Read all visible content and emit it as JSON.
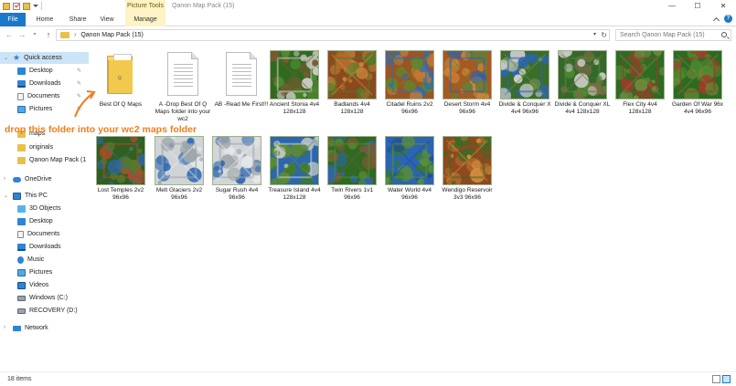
{
  "window": {
    "title": "Qanon Map Pack (15)",
    "context_tab_group": "Picture Tools",
    "controls": [
      "—",
      "☐",
      "✕"
    ]
  },
  "ribbon": {
    "tabs": [
      "File",
      "Home",
      "Share",
      "View",
      "Manage"
    ],
    "accent_color": "#1979ca",
    "context_color": "#fdf3c4"
  },
  "address": {
    "path": "Qanon Map Pack (15)",
    "search_placeholder": "Search Qanon Map Pack (15)"
  },
  "nav": {
    "items": [
      {
        "label": "Quick access",
        "icon": "star-icon",
        "selected": true
      },
      {
        "label": "Desktop",
        "icon": "desktop-icon",
        "pinned": true
      },
      {
        "label": "Downloads",
        "icon": "downloads-icon",
        "pinned": true
      },
      {
        "label": "Documents",
        "icon": "documents-icon",
        "pinned": true
      },
      {
        "label": "Pictures",
        "icon": "pictures-icon",
        "pinned": true
      },
      {
        "label": "maps",
        "icon": "folder-icon"
      },
      {
        "label": "originals",
        "icon": "folder-icon"
      },
      {
        "label": "Qanon Map Pack (1",
        "icon": "folder-icon"
      },
      {
        "label": "OneDrive",
        "icon": "cloud-icon"
      },
      {
        "label": "This PC",
        "icon": "pc-icon"
      },
      {
        "label": "3D Objects",
        "icon": "3d-objects-icon"
      },
      {
        "label": "Desktop",
        "icon": "desktop-icon"
      },
      {
        "label": "Documents",
        "icon": "documents-icon"
      },
      {
        "label": "Downloads",
        "icon": "downloads-icon"
      },
      {
        "label": "Music",
        "icon": "music-icon"
      },
      {
        "label": "Pictures",
        "icon": "pictures-icon"
      },
      {
        "label": "Videos",
        "icon": "videos-icon"
      },
      {
        "label": "Windows (C:)",
        "icon": "drive-icon"
      },
      {
        "label": "RECOVERY (D:)",
        "icon": "drive-icon"
      },
      {
        "label": "Network",
        "icon": "network-icon"
      }
    ]
  },
  "files": [
    {
      "label": "Best Of Q Maps",
      "kind": "folder"
    },
    {
      "label": "A -Drop Best Of Q Maps folder into your wc2",
      "kind": "doc"
    },
    {
      "label": "AB -Read Me First!!!",
      "kind": "doc"
    },
    {
      "label": "Ancient Stonia 4v4 128x128",
      "kind": "map",
      "palette": [
        "#2f6a1f",
        "#4d8c2e",
        "#c9c9c2",
        "#7a5a32"
      ]
    },
    {
      "label": "Badlands 4v4 128x128",
      "kind": "map",
      "palette": [
        "#8a4a1e",
        "#b36a2c",
        "#4f7a2a",
        "#d08b3d"
      ]
    },
    {
      "label": "Citadel Ruins 2v2 96x96",
      "kind": "map",
      "palette": [
        "#9b5424",
        "#c47a33",
        "#2f6db1",
        "#5c8a2c"
      ]
    },
    {
      "label": "Desert Storm 4v4 96x96",
      "kind": "map",
      "palette": [
        "#a55a22",
        "#d08a3a",
        "#2b63aa",
        "#6b7a33"
      ]
    },
    {
      "label": "Divide & Conquer X 4v4 96x96",
      "kind": "map",
      "palette": [
        "#3a6d2a",
        "#c9cbc5",
        "#2d64b0",
        "#6e8f46"
      ]
    },
    {
      "label": "Divide & Conquer XL 4v4 128x128",
      "kind": "map",
      "palette": [
        "#34692b",
        "#c7cac3",
        "#4e8a32",
        "#7c6b45"
      ]
    },
    {
      "label": "Flex City 4v4 128x128",
      "kind": "map",
      "palette": [
        "#2e6b23",
        "#4f8a30",
        "#9e3b2a",
        "#6e8c3c"
      ]
    },
    {
      "label": "Garden Of War 96x 4v4 96x96",
      "kind": "map",
      "palette": [
        "#2d6a21",
        "#4b8a2d",
        "#9c3e29",
        "#6a8837"
      ]
    },
    {
      "label": "Lost Temples 2v2 96x96",
      "kind": "map",
      "palette": [
        "#315f22",
        "#4c7e2d",
        "#b04b2a",
        "#2d67ad"
      ]
    },
    {
      "label": "Melt Glaciers 2v2 96x96",
      "kind": "map",
      "palette": [
        "#d0d4d6",
        "#2f6bb4",
        "#9fa7ab",
        "#e6e9ea"
      ]
    },
    {
      "label": "Sugar Rush 4v4 96x96",
      "kind": "map",
      "palette": [
        "#d3d6d8",
        "#2e68b2",
        "#a2a8ac",
        "#e5e8e9"
      ]
    },
    {
      "label": "Treasure Island 4v4 128x128",
      "kind": "map",
      "palette": [
        "#2c66b1",
        "#3e7a2d",
        "#c9ccc6",
        "#5b8a36"
      ]
    },
    {
      "label": "Twin Rivers 1v1 96x96",
      "kind": "map",
      "palette": [
        "#2f6a22",
        "#2d66b0",
        "#4e8a2e",
        "#7a5a32"
      ]
    },
    {
      "label": "Water World 4v4 96x96",
      "kind": "map",
      "palette": [
        "#2b64b0",
        "#3a7a2c",
        "#5a8f38",
        "#1f4f92"
      ]
    },
    {
      "label": "Wendigo Reservoir 3v3 96x96",
      "kind": "map",
      "palette": [
        "#8c4a1e",
        "#b66d2e",
        "#3c6a27",
        "#d38e3e"
      ]
    }
  ],
  "annotation": {
    "text": "drop this folder into your wc2 maps folder",
    "color": "#f07d1c"
  },
  "status": {
    "count": "18 items"
  }
}
